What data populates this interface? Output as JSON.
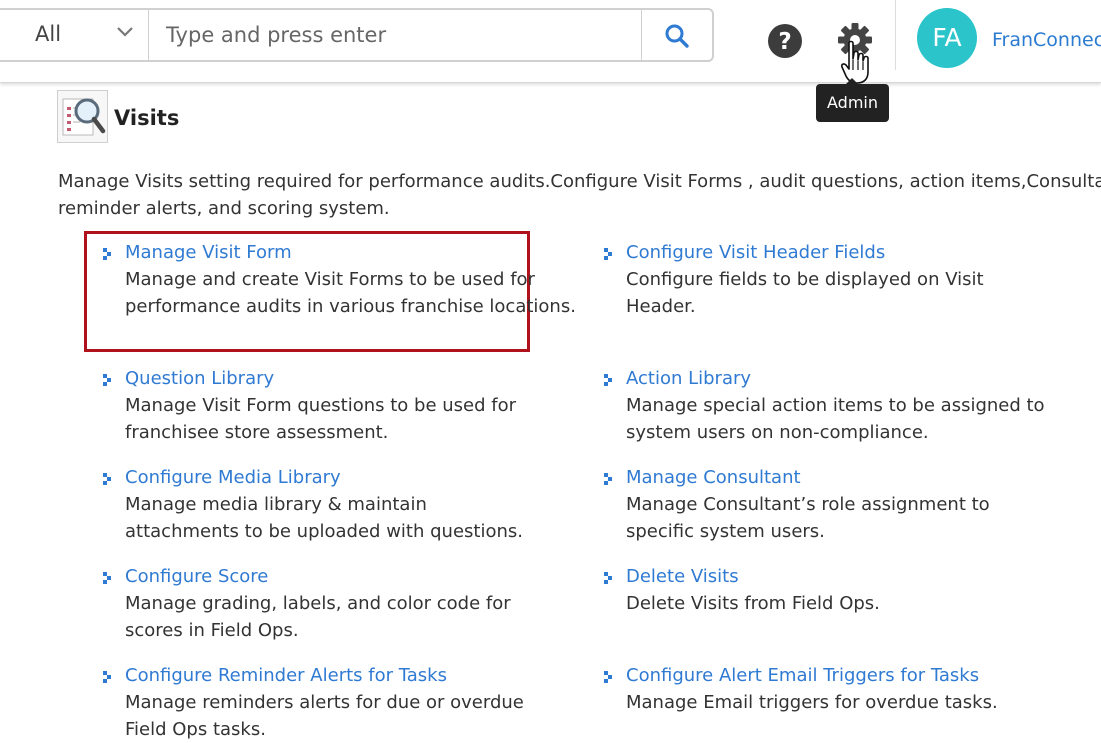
{
  "search": {
    "scope_value": "All",
    "placeholder": "Type and press enter"
  },
  "header": {
    "user_initials": "FA",
    "user_name": "FranConnect",
    "tooltip": "Admin",
    "avatar_color": "#2bc4cb"
  },
  "section": {
    "title": "Visits",
    "description": "Manage Visits setting required for performance audits.Configure Visit Forms , audit questions, action items,Consultant’s reminder alerts, and scoring system."
  },
  "items": [
    {
      "link": "Manage Visit Form",
      "desc": "Manage and create Visit Forms to be used for performance audits in various franchise locations."
    },
    {
      "link": "Configure Visit Header Fields",
      "desc": "Configure fields to be displayed on Visit Header."
    },
    {
      "link": "Question Library",
      "desc": "Manage Visit Form questions to be used for franchisee store assessment."
    },
    {
      "link": "Action Library",
      "desc": "Manage special action items to be assigned to system users on non-compliance."
    },
    {
      "link": "Configure Media Library",
      "desc": "Manage media library & maintain attachments to be uploaded with questions."
    },
    {
      "link": "Manage Consultant",
      "desc": "Manage Consultant’s role assignment to specific system users."
    },
    {
      "link": "Configure Score",
      "desc": "Manage grading, labels, and color code for scores in Field Ops."
    },
    {
      "link": "Delete Visits",
      "desc": "Delete Visits from Field Ops."
    },
    {
      "link": "Configure Reminder Alerts for Tasks",
      "desc": "Manage reminders alerts for due or overdue Field Ops tasks."
    },
    {
      "link": "Configure Alert Email Triggers for Tasks",
      "desc": "Manage Email triggers for overdue tasks."
    }
  ],
  "colors": {
    "link": "#2f7ad2",
    "highlight_border": "#b0121b"
  }
}
